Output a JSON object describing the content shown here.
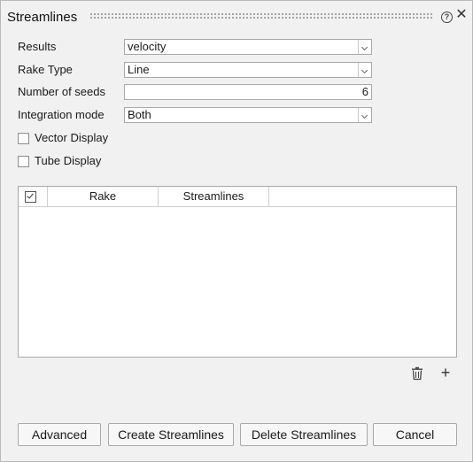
{
  "panel": {
    "title": "Streamlines"
  },
  "form": {
    "results": {
      "label": "Results",
      "value": "velocity"
    },
    "rake_type": {
      "label": "Rake Type",
      "value": "Line"
    },
    "seeds": {
      "label": "Number of seeds",
      "value": "6"
    },
    "integration": {
      "label": "Integration mode",
      "value": "Both"
    },
    "vector_display": {
      "label": "Vector Display",
      "checked": false
    },
    "tube_display": {
      "label": "Tube Display",
      "checked": false
    }
  },
  "table": {
    "columns": [
      "Rake",
      "Streamlines"
    ],
    "rows": []
  },
  "toolbar": {
    "delete_icon": "trash-icon",
    "add_icon": "plus-icon"
  },
  "buttons": {
    "advanced": "Advanced",
    "create": "Create Streamlines",
    "delete": "Delete Streamlines",
    "cancel": "Cancel"
  },
  "icons": {
    "help": "?",
    "close": "✕",
    "add": "+"
  }
}
